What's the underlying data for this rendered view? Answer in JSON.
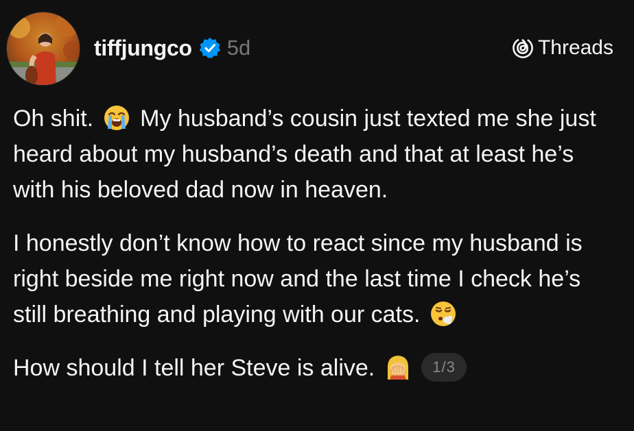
{
  "post": {
    "author": {
      "username": "tiffjungco",
      "verified": true,
      "avatar_icon": "profile-photo"
    },
    "timestamp": "5d",
    "brand": {
      "label": "Threads",
      "icon": "threads-logo-icon"
    },
    "paragraphs": [
      {
        "before_emoji": "Oh shit.",
        "emoji": "loudly-crying-face-emoji",
        "after_emoji": "My husband’s cousin just texted me she just heard about my husband’s death and that at least he’s with his beloved dad now in heaven."
      },
      {
        "text": "I honestly don’t know how to react since my husband is right beside me right now and the last time I check he’s still breathing and playing with our cats.",
        "emoji": "face-exhaling-emoji"
      },
      {
        "text": "How should I tell her Steve is alive.",
        "emoji": "woman-facepalming-emoji"
      }
    ],
    "page_indicator": "1/3"
  },
  "colors": {
    "background": "#101010",
    "text": "#f3f5f7",
    "muted": "#777777",
    "verified_blue": "#0095f6",
    "badge_bg": "#2a2a2a"
  }
}
